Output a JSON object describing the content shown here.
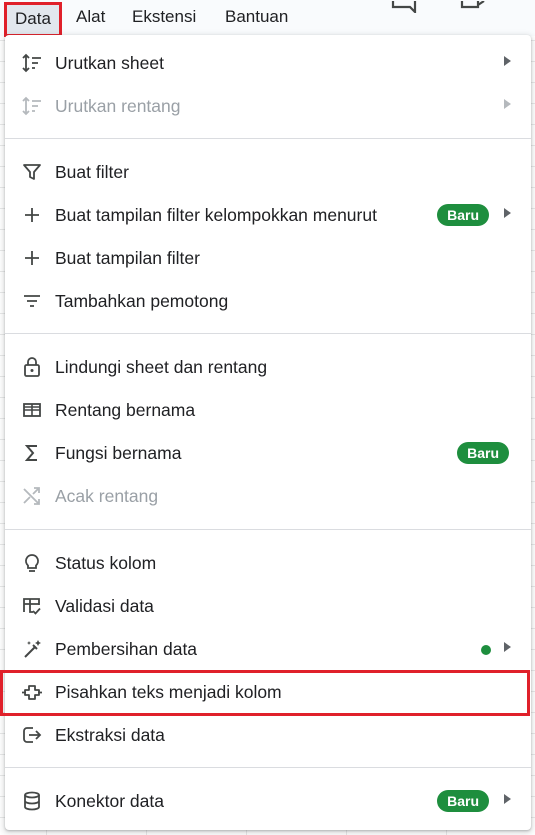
{
  "menubar": {
    "items": [
      "Data",
      "Alat",
      "Ekstensi",
      "Bantuan"
    ]
  },
  "menu": {
    "items": [
      {
        "label": "Urutkan sheet",
        "icon": "sort-icon",
        "submenu": true,
        "disabled": false
      },
      {
        "label": "Urutkan rentang",
        "icon": "sort-icon",
        "submenu": true,
        "disabled": true
      },
      {
        "label": "Buat filter",
        "icon": "filter-icon",
        "submenu": false,
        "disabled": false
      },
      {
        "label": "Buat tampilan filter kelompokkan menurut",
        "icon": "plus-icon",
        "submenu": true,
        "badge": "Baru",
        "disabled": false
      },
      {
        "label": "Buat tampilan filter",
        "icon": "plus-icon",
        "submenu": false,
        "disabled": false
      },
      {
        "label": "Tambahkan pemotong",
        "icon": "slicer-icon",
        "submenu": false,
        "disabled": false
      },
      {
        "label": "Lindungi sheet dan rentang",
        "icon": "lock-icon",
        "submenu": false,
        "disabled": false
      },
      {
        "label": "Rentang bernama",
        "icon": "named-range-icon",
        "submenu": false,
        "disabled": false
      },
      {
        "label": "Fungsi bernama",
        "icon": "sigma-icon",
        "submenu": false,
        "badge": "Baru",
        "disabled": false
      },
      {
        "label": "Acak rentang",
        "icon": "shuffle-icon",
        "submenu": false,
        "disabled": true
      },
      {
        "label": "Status kolom",
        "icon": "lightbulb-icon",
        "submenu": false,
        "disabled": false
      },
      {
        "label": "Validasi data",
        "icon": "validation-icon",
        "submenu": false,
        "disabled": false
      },
      {
        "label": "Pembersihan data",
        "icon": "magic-wand-icon",
        "submenu": true,
        "dot": true,
        "disabled": false
      },
      {
        "label": "Pisahkan teks menjadi kolom",
        "icon": "split-columns-icon",
        "submenu": false,
        "disabled": false
      },
      {
        "label": "Ekstraksi data",
        "icon": "extract-icon",
        "submenu": false,
        "disabled": false
      },
      {
        "label": "Konektor data",
        "icon": "database-icon",
        "submenu": true,
        "badge": "Baru",
        "disabled": false
      }
    ]
  },
  "colors": {
    "badge": "#1e8e3e",
    "highlight": "#e0202a"
  }
}
